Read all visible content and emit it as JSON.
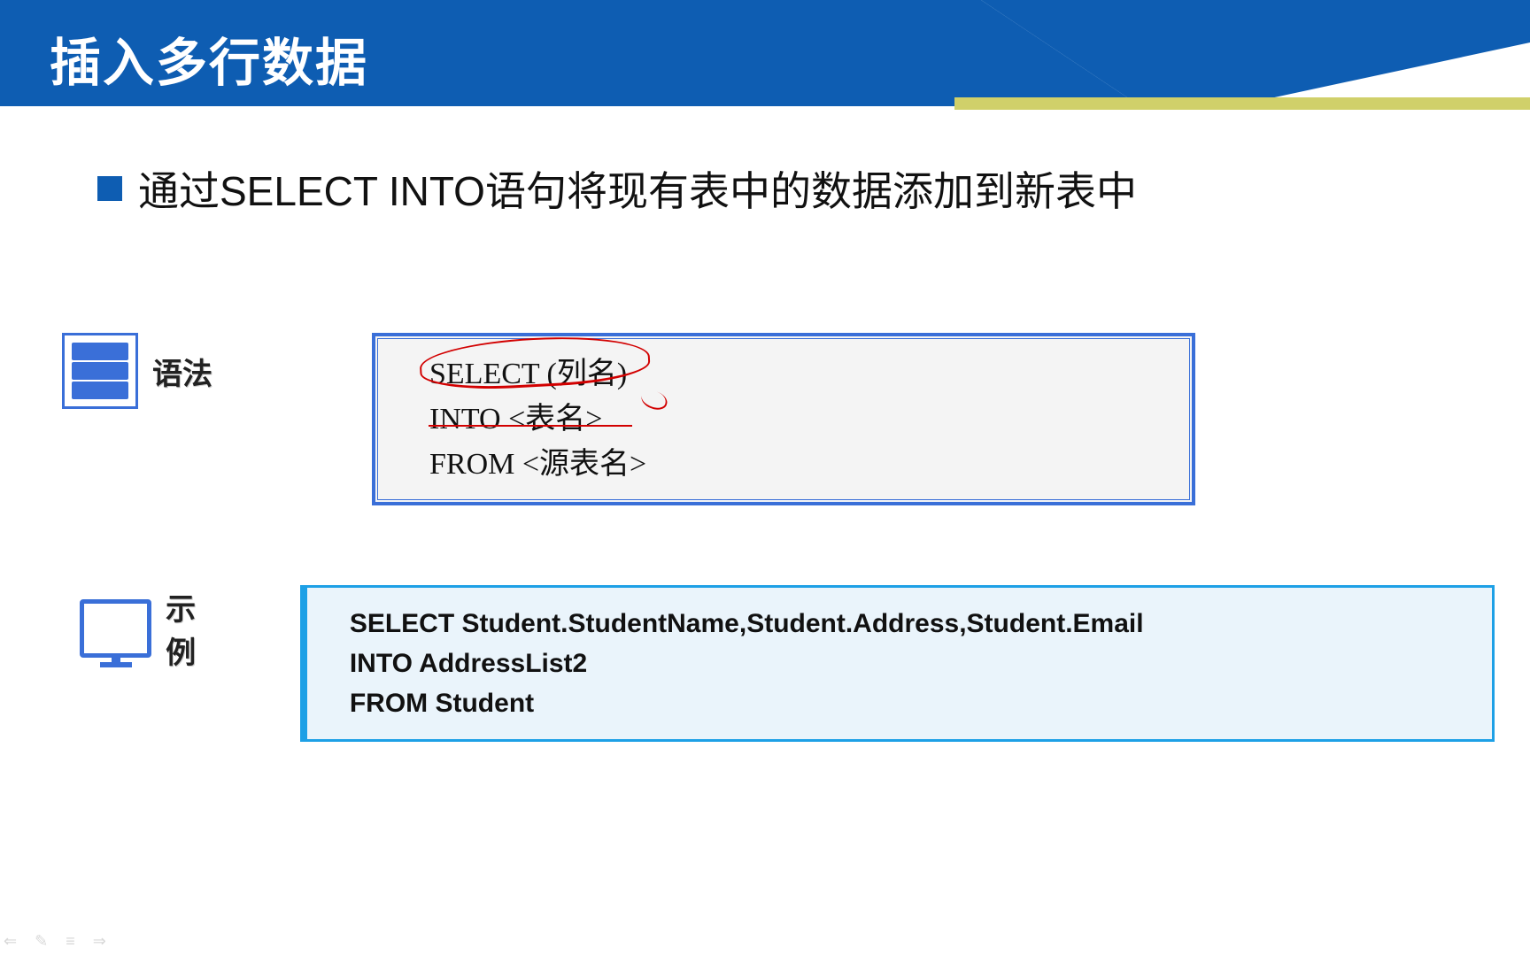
{
  "header": {
    "title": "插入多行数据"
  },
  "subtitle": "通过SELECT INTO语句将现有表中的数据添加到新表中",
  "syntax": {
    "label": "语法",
    "lines": {
      "l1": "SELECT (列名)",
      "l2": "INTO <表名>",
      "l3": "FROM <源表名>"
    }
  },
  "example": {
    "label": "示例",
    "lines": {
      "l1": "SELECT Student.StudentName,Student.Address,Student.Email",
      "l2": "INTO AddressList2",
      "l3": "FROM Student"
    }
  },
  "toolbar": {
    "icons": {
      "back": "⇐",
      "pen": "✎",
      "menu": "≡",
      "fwd": "⇒"
    }
  }
}
